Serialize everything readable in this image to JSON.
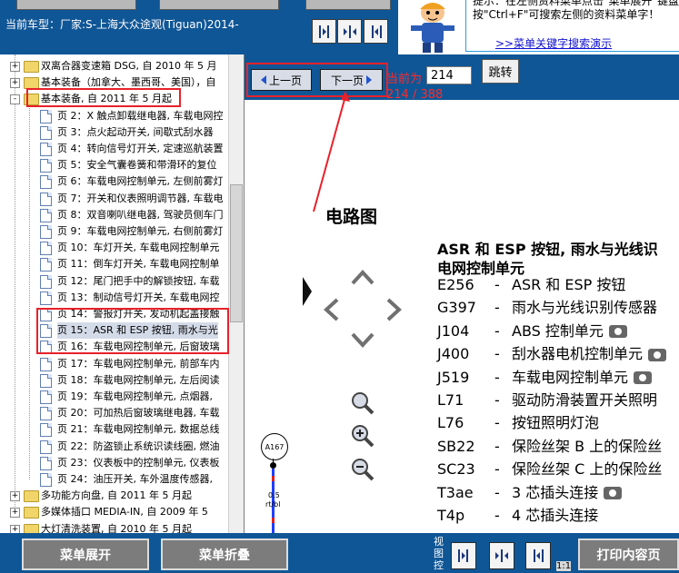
{
  "header": {
    "car_model": "当前车型：厂家:S-上海大众途观(Tiguan)2014-",
    "tip_text": "提示：在左侧资料菜单点击\"菜单展开\"键盘按\"Ctrl+F\"可搜索左侧的资料菜单字！",
    "tip_link": ">>菜单关键字搜索演示"
  },
  "tree": {
    "items": [
      {
        "label": "双离合器变速箱 DSG, 自 2010 年 5 月",
        "type": "folder",
        "expander": "+"
      },
      {
        "label": "基本装备（加拿大、墨西哥、美国），自",
        "type": "folder",
        "expander": "+"
      },
      {
        "label": "基本装备, 自 2011 年 5 月起",
        "type": "folder",
        "expander": "-"
      },
      {
        "label": "页 2：X 触点卸载继电器, 车载电网控",
        "type": "page"
      },
      {
        "label": "页 3：点火起动开关, 间歇式刮水器",
        "type": "page"
      },
      {
        "label": "页 4：转向信号灯开关, 定速巡航装置",
        "type": "page"
      },
      {
        "label": "页 5：安全气囊卷簧和带滑环的复位",
        "type": "page"
      },
      {
        "label": "页 6：车载电网控制单元, 左侧前雾灯",
        "type": "page"
      },
      {
        "label": "页 7：开关和仪表照明调节器, 车载电",
        "type": "page"
      },
      {
        "label": "页 8：双音喇叭继电器, 驾驶员侧车门",
        "type": "page"
      },
      {
        "label": "页 9：车载电网控制单元, 右侧前雾灯",
        "type": "page"
      },
      {
        "label": "页 10：车灯开关, 车载电网控制单元",
        "type": "page"
      },
      {
        "label": "页 11：倒车灯开关, 车载电网控制单",
        "type": "page"
      },
      {
        "label": "页 12：尾门把手中的解锁按钮, 车载",
        "type": "page"
      },
      {
        "label": "页 13：制动信号灯开关, 车载电网控",
        "type": "page"
      },
      {
        "label": "页 14：警报灯开关, 发动机起盖接触",
        "type": "page"
      },
      {
        "label": "页 15：ASR 和 ESP 按钮, 雨水与光",
        "type": "page"
      },
      {
        "label": "页 16：车载电网控制单元, 后窗玻璃",
        "type": "page"
      },
      {
        "label": "页 17：车载电网控制单元, 前部车内",
        "type": "page"
      },
      {
        "label": "页 18：车载电网控制单元, 左后阅读",
        "type": "page"
      },
      {
        "label": "页 19：车载电网控制单元, 点烟器,",
        "type": "page"
      },
      {
        "label": "页 20：可加热后窗玻璃继电器, 车载",
        "type": "page"
      },
      {
        "label": "页 21：车载电网控制单元, 数据总线",
        "type": "page"
      },
      {
        "label": "页 22：防盗锁止系统识读线圈, 燃油",
        "type": "page"
      },
      {
        "label": "页 23：仪表板中的控制单元, 仪表板",
        "type": "page"
      },
      {
        "label": "页 24：油压开关, 车外温度传感器,",
        "type": "page"
      },
      {
        "label": "多功能方向盘, 自 2011 年 5 月起",
        "type": "folder",
        "expander": "+"
      },
      {
        "label": "多媒体插口 MEDIA-IN, 自 2009 年 5",
        "type": "folder",
        "expander": "+"
      },
      {
        "label": "大灯清洗装置, 自 2010 年 5 月起",
        "type": "folder",
        "expander": "+"
      }
    ]
  },
  "viewer": {
    "prev_label": "上一页",
    "next_label": "下一页",
    "page_label": "当前为",
    "page_value": "214",
    "page_count": "214 / 388",
    "jump_label": "跳转",
    "section_title": "电路图",
    "legend_title_line1": "ASR 和 ESP 按钮, 雨水与光线识",
    "legend_title_line2": "电网控制单元",
    "connector_label": "A167",
    "wire_label_1": "0.5",
    "wire_label_2": "rt/bl",
    "legend": [
      {
        "code": "E256",
        "desc": "ASR 和 ESP 按钮",
        "camera": false
      },
      {
        "code": "G397",
        "desc": "雨水与光线识别传感器",
        "camera": false
      },
      {
        "code": "J104",
        "desc": "ABS 控制单元",
        "camera": true
      },
      {
        "code": "J400",
        "desc": "刮水器电机控制单元",
        "camera": true
      },
      {
        "code": "J519",
        "desc": "车载电网控制单元",
        "camera": true
      },
      {
        "code": "L71",
        "desc": "驱动防滑装置开关照明",
        "camera": false
      },
      {
        "code": "L76",
        "desc": "按钮照明灯泡",
        "camera": false
      },
      {
        "code": "SB22",
        "desc": "保险丝架 B 上的保险丝",
        "camera": false
      },
      {
        "code": "SC23",
        "desc": "保险丝架 C 上的保险丝",
        "camera": false
      },
      {
        "code": "T3ae",
        "desc": "3 芯插头连接",
        "camera": true
      },
      {
        "code": "T4p",
        "desc": "4 芯插头连接",
        "camera": false
      }
    ]
  },
  "footer": {
    "expand_label": "菜单展开",
    "collapse_label": "菜单折叠",
    "view_ctrl_label": "视图控",
    "scale_text": "1:1",
    "print_label": "打印内容页"
  },
  "colors": {
    "bar_blue": "#0f5696",
    "highlight_red": "#e8212a",
    "page_counter_red": "#ff2a2a"
  }
}
